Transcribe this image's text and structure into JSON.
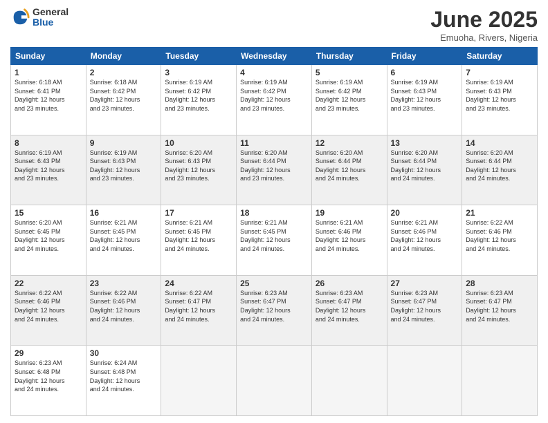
{
  "logo": {
    "general": "General",
    "blue": "Blue"
  },
  "title": "June 2025",
  "subtitle": "Emuoha, Rivers, Nigeria",
  "headers": [
    "Sunday",
    "Monday",
    "Tuesday",
    "Wednesday",
    "Thursday",
    "Friday",
    "Saturday"
  ],
  "weeks": [
    [
      {
        "num": "1",
        "info": "Sunrise: 6:18 AM\nSunset: 6:41 PM\nDaylight: 12 hours\nand 23 minutes."
      },
      {
        "num": "2",
        "info": "Sunrise: 6:18 AM\nSunset: 6:42 PM\nDaylight: 12 hours\nand 23 minutes."
      },
      {
        "num": "3",
        "info": "Sunrise: 6:19 AM\nSunset: 6:42 PM\nDaylight: 12 hours\nand 23 minutes."
      },
      {
        "num": "4",
        "info": "Sunrise: 6:19 AM\nSunset: 6:42 PM\nDaylight: 12 hours\nand 23 minutes."
      },
      {
        "num": "5",
        "info": "Sunrise: 6:19 AM\nSunset: 6:42 PM\nDaylight: 12 hours\nand 23 minutes."
      },
      {
        "num": "6",
        "info": "Sunrise: 6:19 AM\nSunset: 6:43 PM\nDaylight: 12 hours\nand 23 minutes."
      },
      {
        "num": "7",
        "info": "Sunrise: 6:19 AM\nSunset: 6:43 PM\nDaylight: 12 hours\nand 23 minutes."
      }
    ],
    [
      {
        "num": "8",
        "info": "Sunrise: 6:19 AM\nSunset: 6:43 PM\nDaylight: 12 hours\nand 23 minutes."
      },
      {
        "num": "9",
        "info": "Sunrise: 6:19 AM\nSunset: 6:43 PM\nDaylight: 12 hours\nand 23 minutes."
      },
      {
        "num": "10",
        "info": "Sunrise: 6:20 AM\nSunset: 6:43 PM\nDaylight: 12 hours\nand 23 minutes."
      },
      {
        "num": "11",
        "info": "Sunrise: 6:20 AM\nSunset: 6:44 PM\nDaylight: 12 hours\nand 23 minutes."
      },
      {
        "num": "12",
        "info": "Sunrise: 6:20 AM\nSunset: 6:44 PM\nDaylight: 12 hours\nand 24 minutes."
      },
      {
        "num": "13",
        "info": "Sunrise: 6:20 AM\nSunset: 6:44 PM\nDaylight: 12 hours\nand 24 minutes."
      },
      {
        "num": "14",
        "info": "Sunrise: 6:20 AM\nSunset: 6:44 PM\nDaylight: 12 hours\nand 24 minutes."
      }
    ],
    [
      {
        "num": "15",
        "info": "Sunrise: 6:20 AM\nSunset: 6:45 PM\nDaylight: 12 hours\nand 24 minutes."
      },
      {
        "num": "16",
        "info": "Sunrise: 6:21 AM\nSunset: 6:45 PM\nDaylight: 12 hours\nand 24 minutes."
      },
      {
        "num": "17",
        "info": "Sunrise: 6:21 AM\nSunset: 6:45 PM\nDaylight: 12 hours\nand 24 minutes."
      },
      {
        "num": "18",
        "info": "Sunrise: 6:21 AM\nSunset: 6:45 PM\nDaylight: 12 hours\nand 24 minutes."
      },
      {
        "num": "19",
        "info": "Sunrise: 6:21 AM\nSunset: 6:46 PM\nDaylight: 12 hours\nand 24 minutes."
      },
      {
        "num": "20",
        "info": "Sunrise: 6:21 AM\nSunset: 6:46 PM\nDaylight: 12 hours\nand 24 minutes."
      },
      {
        "num": "21",
        "info": "Sunrise: 6:22 AM\nSunset: 6:46 PM\nDaylight: 12 hours\nand 24 minutes."
      }
    ],
    [
      {
        "num": "22",
        "info": "Sunrise: 6:22 AM\nSunset: 6:46 PM\nDaylight: 12 hours\nand 24 minutes."
      },
      {
        "num": "23",
        "info": "Sunrise: 6:22 AM\nSunset: 6:46 PM\nDaylight: 12 hours\nand 24 minutes."
      },
      {
        "num": "24",
        "info": "Sunrise: 6:22 AM\nSunset: 6:47 PM\nDaylight: 12 hours\nand 24 minutes."
      },
      {
        "num": "25",
        "info": "Sunrise: 6:23 AM\nSunset: 6:47 PM\nDaylight: 12 hours\nand 24 minutes."
      },
      {
        "num": "26",
        "info": "Sunrise: 6:23 AM\nSunset: 6:47 PM\nDaylight: 12 hours\nand 24 minutes."
      },
      {
        "num": "27",
        "info": "Sunrise: 6:23 AM\nSunset: 6:47 PM\nDaylight: 12 hours\nand 24 minutes."
      },
      {
        "num": "28",
        "info": "Sunrise: 6:23 AM\nSunset: 6:47 PM\nDaylight: 12 hours\nand 24 minutes."
      }
    ],
    [
      {
        "num": "29",
        "info": "Sunrise: 6:23 AM\nSunset: 6:48 PM\nDaylight: 12 hours\nand 24 minutes."
      },
      {
        "num": "30",
        "info": "Sunrise: 6:24 AM\nSunset: 6:48 PM\nDaylight: 12 hours\nand 24 minutes."
      },
      null,
      null,
      null,
      null,
      null
    ]
  ]
}
